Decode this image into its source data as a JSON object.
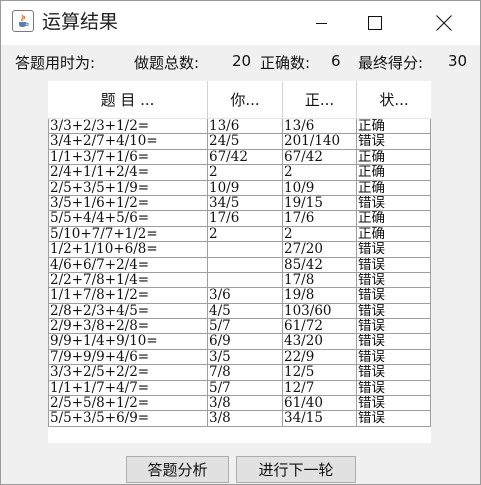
{
  "window": {
    "title": "运算结果",
    "icon": "java-cup-icon"
  },
  "stats": {
    "time_label": "答题用时为:",
    "total_label": "做题总数:",
    "total_value": "20",
    "correct_label": "正确数:",
    "correct_value": "6",
    "score_label": "最终得分:",
    "score_value": "30"
  },
  "table": {
    "headers": [
      "题 目 ...",
      "你...",
      "正...",
      "状..."
    ],
    "rows": [
      [
        "3/3+2/3+1/2=",
        "13/6",
        "13/6",
        "正确"
      ],
      [
        "3/4+2/7+4/10=",
        "24/5",
        "201/140",
        "错误"
      ],
      [
        "1/1+3/7+1/6=",
        "67/42",
        "67/42",
        "正确"
      ],
      [
        "2/4+1/1+2/4=",
        "2",
        "2",
        "正确"
      ],
      [
        "2/5+3/5+1/9=",
        "10/9",
        "10/9",
        "正确"
      ],
      [
        "3/5+1/6+1/2=",
        "34/5",
        "19/15",
        "错误"
      ],
      [
        "5/5+4/4+5/6=",
        "17/6",
        "17/6",
        "正确"
      ],
      [
        "5/10+7/7+1/2=",
        "2",
        "2",
        "正确"
      ],
      [
        "1/2+1/10+6/8=",
        "",
        "27/20",
        "错误"
      ],
      [
        "4/6+6/7+2/4=",
        "",
        "85/42",
        "错误"
      ],
      [
        "2/2+7/8+1/4=",
        "",
        "17/8",
        "错误"
      ],
      [
        "1/1+7/8+1/2=",
        "3/6",
        "19/8",
        "错误"
      ],
      [
        "2/8+2/3+4/5=",
        "4/5",
        "103/60",
        "错误"
      ],
      [
        "2/9+3/8+2/8=",
        "5/7",
        "61/72",
        "错误"
      ],
      [
        "9/9+1/4+9/10=",
        "6/9",
        "43/20",
        "错误"
      ],
      [
        "7/9+9/9+4/6=",
        "3/5",
        "22/9",
        "错误"
      ],
      [
        "3/3+2/5+2/2=",
        "7/8",
        "12/5",
        "错误"
      ],
      [
        "1/1+1/7+4/7=",
        "5/7",
        "12/7",
        "错误"
      ],
      [
        "2/5+5/8+1/2=",
        "3/8",
        "61/40",
        "错误"
      ],
      [
        "5/5+3/5+6/9=",
        "3/8",
        "34/15",
        "错误"
      ]
    ]
  },
  "buttons": {
    "analyze": "答题分析",
    "next_round": "进行下一轮"
  }
}
